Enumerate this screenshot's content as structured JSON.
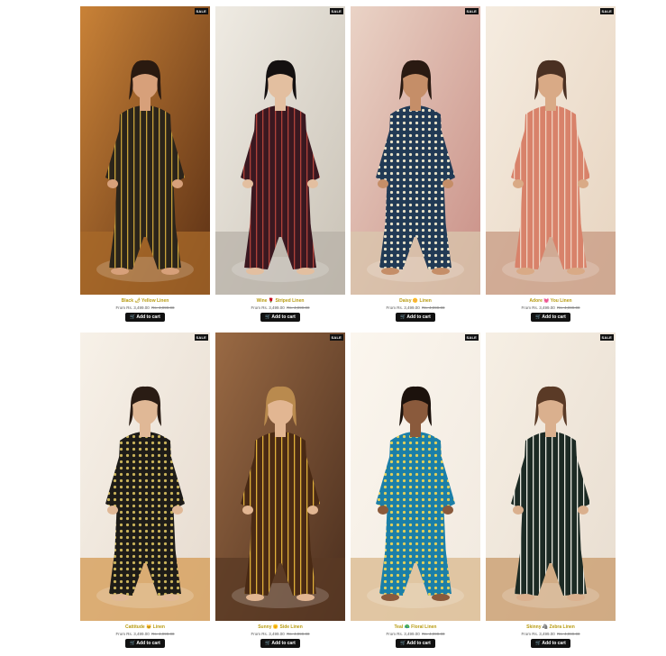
{
  "products": [
    {
      "name": "Black 🌶 Yellow Linen",
      "price_prefix": "From",
      "price": "Rs. 3,499.00",
      "compare_price": "Rs. 4,999.00",
      "badge": "SALE",
      "cart_label": "Add to cart",
      "colors": {
        "bg1": "#5a2f14",
        "bg2": "#c98237",
        "cloth": "#2b241a",
        "stripe": "#c9a23a",
        "skin": "#d7a07a",
        "hair": "#2a1a10",
        "floor": "#a86a2a"
      }
    },
    {
      "name": "Wine 🌹 Striped Linen",
      "price_prefix": "From",
      "price": "Rs. 3,499.00",
      "compare_price": "Rs. 4,999.00",
      "badge": "SALE",
      "cart_label": "Add to cart",
      "colors": {
        "bg1": "#c9c2b6",
        "bg2": "#efebe3",
        "cloth": "#3a1820",
        "stripe": "#b0423a",
        "skin": "#e3bfa0",
        "hair": "#141010",
        "floor": "#b8b2a8"
      }
    },
    {
      "name": "Daisy 🌼 Linen",
      "price_prefix": "From",
      "price": "Rs. 3,499.00",
      "compare_price": "Rs. 4,999.00",
      "badge": "SALE",
      "cart_label": "Add to cart",
      "colors": {
        "bg1": "#c98f86",
        "bg2": "#ead3c6",
        "cloth": "#213a55",
        "stripe": "#e8e2c8",
        "skin": "#c58e68",
        "hair": "#2a1a12",
        "floor": "#d9c7ae"
      }
    },
    {
      "name": "Adore 💓 You Linen",
      "price_prefix": "From",
      "price": "Rs. 3,499.00",
      "compare_price": "Rs. 4,999.00",
      "badge": "SALE",
      "cart_label": "Add to cart",
      "colors": {
        "bg1": "#e7d4c0",
        "bg2": "#f5ece0",
        "cloth": "#d8826a",
        "stripe": "#f0d2c0",
        "skin": "#d9aa86",
        "hair": "#4a3022",
        "floor": "#c79a82"
      }
    },
    {
      "name": "Cattitude 🐱 Linen",
      "price_prefix": "From",
      "price": "Rs. 3,499.00",
      "compare_price": "Rs. 4,999.00",
      "badge": "SALE",
      "cart_label": "Add to cart",
      "colors": {
        "bg1": "#e6dbcf",
        "bg2": "#f7f1e8",
        "cloth": "#1e1c18",
        "stripe": "#c9b25a",
        "skin": "#e0b896",
        "hair": "#2a1c14",
        "floor": "#d49a52"
      }
    },
    {
      "name": "Sunny 🌞 Side Linen",
      "price_prefix": "From",
      "price": "Rs. 3,499.00",
      "compare_price": "Rs. 4,999.00",
      "badge": "SALE",
      "cart_label": "Add to cart",
      "colors": {
        "bg1": "#4a2e1e",
        "bg2": "#9a6a44",
        "cloth": "#4a2a14",
        "stripe": "#e0b03a",
        "skin": "#e2b692",
        "hair": "#b98a4e",
        "floor": "#5a3a24"
      }
    },
    {
      "name": "Teal 🦚 Floral Linen",
      "price_prefix": "From",
      "price": "Rs. 3,499.00",
      "compare_price": "Rs. 4,999.00",
      "badge": "SALE",
      "cart_label": "Add to cart",
      "colors": {
        "bg1": "#f1e9df",
        "bg2": "#fbf6ee",
        "cloth": "#1b7fa8",
        "stripe": "#e0cf5a",
        "skin": "#8a5a3c",
        "hair": "#1c120c",
        "floor": "#d9b88c"
      }
    },
    {
      "name": "Skinny 🦓 Zebra Linen",
      "price_prefix": "From",
      "price": "Rs. 3,499.00",
      "compare_price": "Rs. 4,999.00",
      "badge": "SALE",
      "cart_label": "Add to cart",
      "colors": {
        "bg1": "#e8ddd0",
        "bg2": "#f6efe4",
        "cloth": "#1c2a24",
        "stripe": "#e8e8e0",
        "skin": "#dab08e",
        "hair": "#5a3a26",
        "floor": "#c89a6a"
      }
    }
  ]
}
